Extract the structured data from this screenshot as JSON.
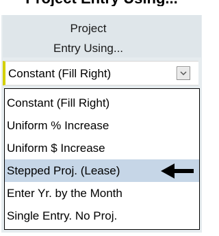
{
  "header": {
    "top_title": "Project Entry Using...",
    "line1": "Project",
    "line2": "Entry Using..."
  },
  "dropdown": {
    "selected_value": "Constant (Fill Right)",
    "options": [
      "Constant (Fill Right)",
      "Uniform % Increase",
      "Uniform $ Increase",
      "Stepped Proj. (Lease)",
      "Enter Yr. by the Month",
      "Single Entry. No Proj."
    ],
    "highlighted_option": "Stepped Proj. (Lease)"
  },
  "colors": {
    "panel_bg": "#e6ecef",
    "highlight": "#c6d6e7",
    "focus_bar": "#d4d000"
  },
  "icons": {
    "dropdown_toggle": "chevron-down-icon",
    "pointer": "arrow-left-icon"
  }
}
